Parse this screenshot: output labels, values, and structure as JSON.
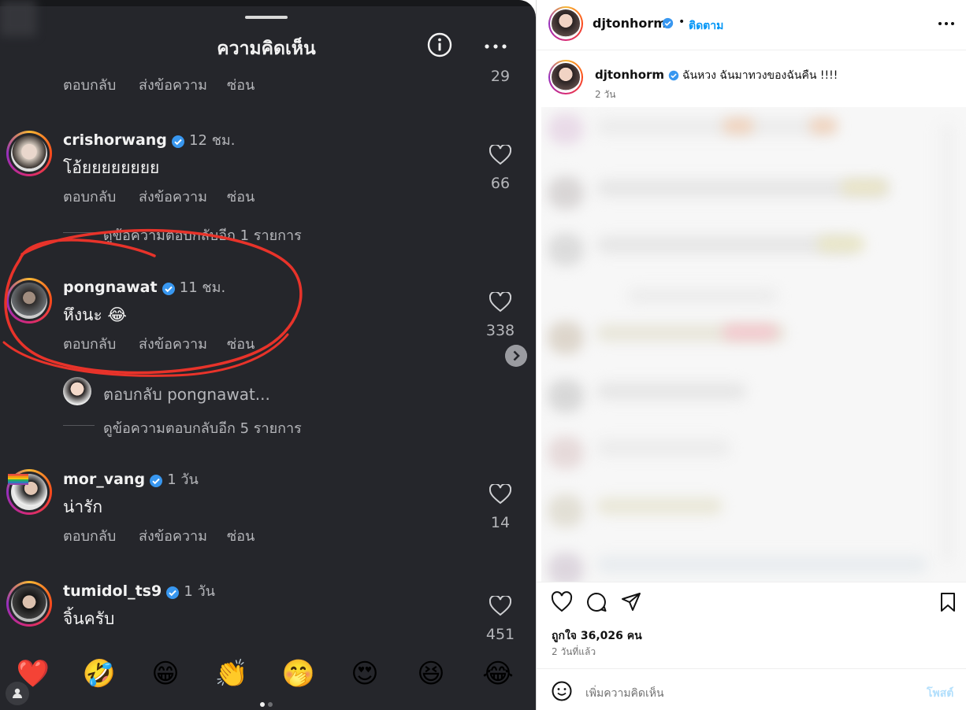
{
  "left_panel": {
    "title": "ความคิดเห็น",
    "top_actions": {
      "reply": "ตอบกลับ",
      "message": "ส่งข้อความ",
      "hide": "ซ่อน",
      "likes": "29"
    },
    "comments": [
      {
        "username": "crishorwang",
        "time": "12 ชม.",
        "text": "โอ้ยยยยยยยย",
        "reply": "ตอบกลับ",
        "message": "ส่งข้อความ",
        "hide": "ซ่อน",
        "likes": "66",
        "more_replies": "ดูข้อความตอบกลับอีก 1 รายการ"
      },
      {
        "username": "pongnawat",
        "time": "11 ชม.",
        "text": "หึงนะ 😂",
        "reply": "ตอบกลับ",
        "message": "ส่งข้อความ",
        "hide": "ซ่อน",
        "likes": "338",
        "reply_prompt": "ตอบกลับ pongnawat...",
        "more_replies": "ดูข้อความตอบกลับอีก 5 รายการ"
      },
      {
        "username": "mor_vang",
        "time": "1 วัน",
        "text": "น่ารัก",
        "reply": "ตอบกลับ",
        "message": "ส่งข้อความ",
        "hide": "ซ่อน",
        "likes": "14"
      },
      {
        "username": "tumidol_ts9",
        "time": "1 วัน",
        "text": "จิ้นครับ",
        "likes": "451"
      }
    ],
    "emoji_bar": [
      "❤️",
      "🤣",
      "😁",
      "👏",
      "🤭",
      "😍",
      "😆",
      "😂"
    ]
  },
  "right_panel": {
    "header": {
      "username": "djtonhorm",
      "follow": "ติดตาม"
    },
    "caption": {
      "username": "djtonhorm",
      "text": "ฉันหวง ฉันมาทวงของฉันคืน !!!!",
      "time": "2 วัน"
    },
    "likes": "ถูกใจ 36,026 คน",
    "posted": "2 วันที่แล้ว",
    "comment_placeholder": "เพิ่มความคิดเห็น",
    "post_button": "โพสต์"
  },
  "colors": {
    "dark_bg": "#25262b",
    "verified": "#3897f0",
    "annotation": "#e8332a",
    "link": "#0095f6",
    "post_btn": "#b2dffc"
  }
}
